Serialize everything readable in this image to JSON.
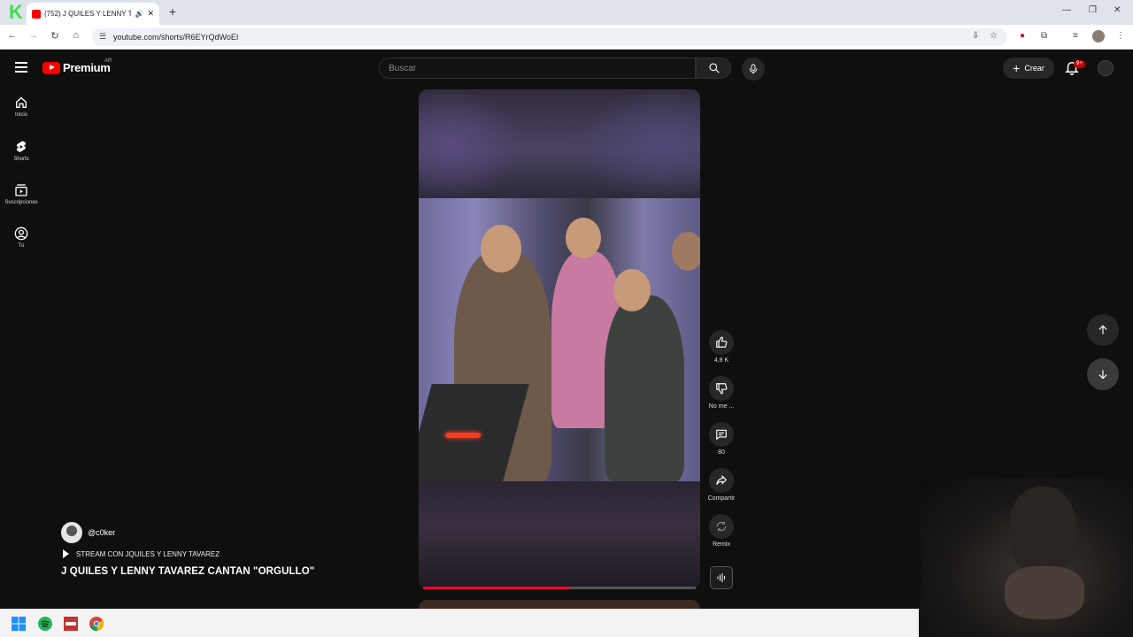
{
  "browser": {
    "tab_title": "(752) J QUILES Y LENNY TA",
    "url": "youtube.com/shorts/R6EYrQdWoEI"
  },
  "youtube": {
    "logo_text": "Premium",
    "region": "AR",
    "search_placeholder": "Buscar",
    "create_label": "Crear",
    "notif_count": "9+"
  },
  "rail": [
    {
      "label": "Inicio",
      "icon": "home-icon"
    },
    {
      "label": "Shorts",
      "icon": "shorts-icon"
    },
    {
      "label": "Suscripciones",
      "icon": "subscriptions-icon"
    },
    {
      "label": "Tú",
      "icon": "you-icon"
    }
  ],
  "actions": {
    "like_count": "4,8 K",
    "dislike_label": "No me ...",
    "comment_count": "80",
    "share_label": "Compartir",
    "remix_label": "Remix"
  },
  "video": {
    "channel": "@c0ker",
    "stream_label": "STREAM CON JQUILES Y LENNY TAVAREZ",
    "title": "J QUILES Y LENNY TAVAREZ CANTAN \"ORGULLO\"",
    "progress_fraction": 0.54
  },
  "colors": {
    "accent": "#ff0033",
    "background": "#0f0f0f",
    "button_bg": "#272727"
  }
}
